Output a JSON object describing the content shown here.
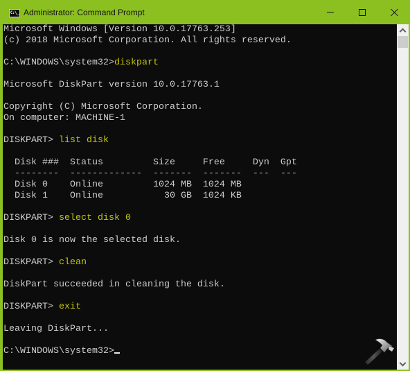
{
  "window": {
    "title": "Administrator: Command Prompt",
    "app_icon_label": "C:\\_",
    "controls": [
      "minimize",
      "maximize",
      "close"
    ]
  },
  "colors": {
    "titlebar": "#8cc021",
    "console_bg": "#0c0c0c",
    "console_text": "#cccccc",
    "command_text": "#c5c50b",
    "scrollbar_bg": "#f0f0f0",
    "scrollbar_thumb": "#cdcdcd"
  },
  "console": {
    "lines": [
      {
        "text": "Microsoft Windows [Version 10.0.17763.253]"
      },
      {
        "text": "(c) 2018 Microsoft Corporation. All rights reserved."
      },
      {
        "text": ""
      },
      {
        "prompt": "C:\\WINDOWS\\system32>",
        "command": "diskpart"
      },
      {
        "text": ""
      },
      {
        "text": "Microsoft DiskPart version 10.0.17763.1"
      },
      {
        "text": ""
      },
      {
        "text": "Copyright (C) Microsoft Corporation."
      },
      {
        "text": "On computer: MACHINE-1"
      },
      {
        "text": ""
      },
      {
        "prompt": "DISKPART> ",
        "command": "list disk"
      },
      {
        "text": ""
      },
      {
        "text": "  Disk ###  Status         Size     Free     Dyn  Gpt"
      },
      {
        "text": "  --------  -------------  -------  -------  ---  ---"
      },
      {
        "text": "  Disk 0    Online         1024 MB  1024 MB"
      },
      {
        "text": "  Disk 1    Online           30 GB  1024 KB"
      },
      {
        "text": ""
      },
      {
        "prompt": "DISKPART> ",
        "command": "select disk 0"
      },
      {
        "text": ""
      },
      {
        "text": "Disk 0 is now the selected disk."
      },
      {
        "text": ""
      },
      {
        "prompt": "DISKPART> ",
        "command": "clean"
      },
      {
        "text": ""
      },
      {
        "text": "DiskPart succeeded in cleaning the disk."
      },
      {
        "text": ""
      },
      {
        "prompt": "DISKPART> ",
        "command": "exit"
      },
      {
        "text": ""
      },
      {
        "text": "Leaving DiskPart..."
      },
      {
        "text": ""
      },
      {
        "prompt": "C:\\WINDOWS\\system32>",
        "command": "",
        "cursor": true
      }
    ]
  },
  "disk_table": {
    "headers": [
      "Disk ###",
      "Status",
      "Size",
      "Free",
      "Dyn",
      "Gpt"
    ],
    "rows": [
      [
        "Disk 0",
        "Online",
        "1024 MB",
        "1024 MB",
        "",
        ""
      ],
      [
        "Disk 1",
        "Online",
        "30 GB",
        "1024 KB",
        "",
        ""
      ]
    ]
  },
  "scrollbar": {
    "position": 0,
    "up_icon": "chevron-up-icon",
    "down_icon": "chevron-down-icon"
  },
  "watermark": {
    "icon": "hammer-icon"
  }
}
